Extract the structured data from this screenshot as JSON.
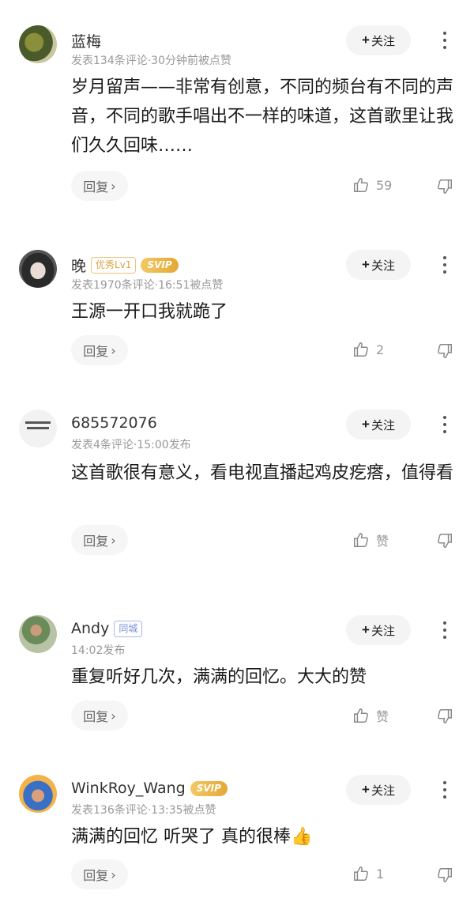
{
  "comments": [
    {
      "name": "蓝梅",
      "badges": [],
      "meta": "发表134条评论·30分钟前被点赞",
      "follow_label": "关注",
      "text": "岁月留声——非常有创意，不同的频台有不同的声音，不同的歌手唱出不一样的味道，这首歌里让我们久久回味……",
      "reply_label": "回复",
      "likes": "59"
    },
    {
      "name": "晚",
      "badges": [
        "优秀Lv1",
        "SVIP"
      ],
      "meta": "发表1970条评论·16:51被点赞",
      "follow_label": "关注",
      "text": "王源一开口我就跪了",
      "reply_label": "回复",
      "likes": "2"
    },
    {
      "name": "685572076",
      "badges": [],
      "meta": "发表4条评论·15:00发布",
      "follow_label": "关注",
      "text": "这首歌很有意义，看电视直播起鸡皮疙瘩，值得看",
      "reply_label": "回复",
      "likes": "赞"
    },
    {
      "name": "Andy",
      "badges": [
        "同城"
      ],
      "meta": "14:02发布",
      "follow_label": "关注",
      "text": "重复听好几次，满满的回忆。大大的赞",
      "reply_label": "回复",
      "likes": "赞"
    },
    {
      "name": "WinkRoy_Wang",
      "badges": [
        "SVIP"
      ],
      "meta": "发表136条评论·13:35被点赞",
      "follow_label": "关注",
      "text": "满满的回忆 听哭了 真的很棒👍",
      "reply_label": "回复",
      "likes": "1"
    }
  ]
}
